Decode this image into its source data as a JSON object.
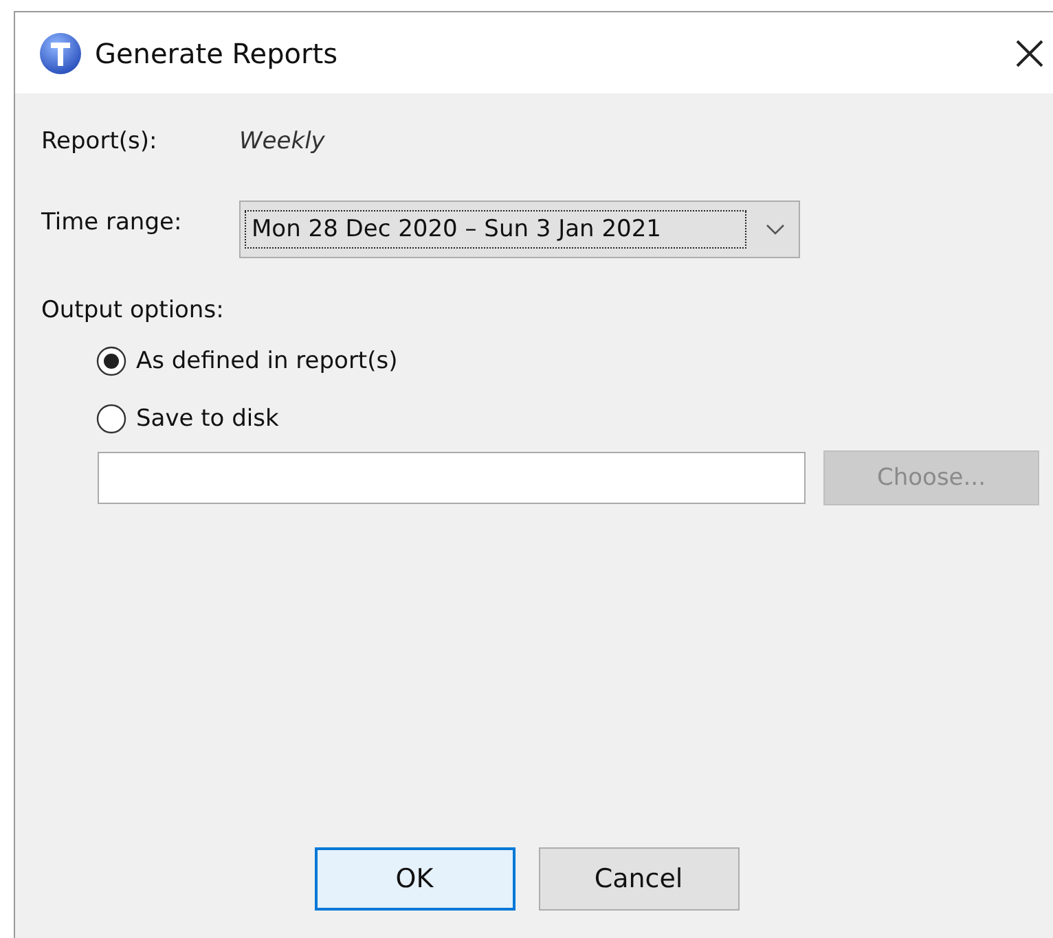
{
  "window": {
    "title": "Generate Reports"
  },
  "report": {
    "label": "Report(s):",
    "value": "Weekly"
  },
  "time_range": {
    "label": "Time range:",
    "value": "Mon 28 Dec 2020 – Sun 3 Jan 2021",
    "focused": true
  },
  "output_options": {
    "label": "Output options:",
    "options": [
      {
        "label": "As defined in report(s)",
        "selected": true
      },
      {
        "label": "Save to disk",
        "selected": false
      }
    ],
    "path_field": {
      "disabled": false
    },
    "choose_button": {
      "label": "Choose...",
      "disabled": true
    }
  },
  "buttons": [
    {
      "label": "OK",
      "default": true
    },
    {
      "label": "Cancel",
      "default": false
    }
  ]
}
